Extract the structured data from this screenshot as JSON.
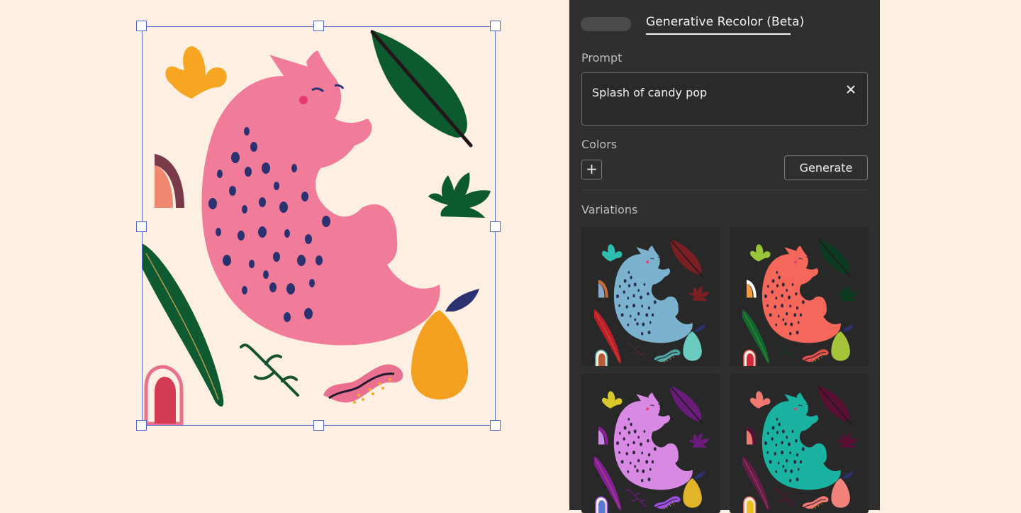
{
  "panel": {
    "tab_label": "Generative Recolor (Beta)",
    "prompt_label": "Prompt",
    "prompt_value": "Splash of candy pop",
    "clear_icon": "close-icon",
    "colors_label": "Colors",
    "add_color_label": "+",
    "generate_label": "Generate",
    "variations_label": "Variations"
  },
  "palettes": {
    "original": {
      "cat": "#f07c9a",
      "spots": "#2c3270",
      "leaf_dark": "#0e5a2f",
      "leaf_tall": "#0f5a30",
      "flower": "#f6a623",
      "pear": "#f3a020",
      "arch": "#f0876f",
      "arch_stroke": "#7a3a4a",
      "plant": "#0e5a2f",
      "wave": "#e9718f",
      "dots": "#f0b020",
      "door": "#d53a55",
      "sprig": "#16522f"
    },
    "variations": [
      {
        "cat": "#7bb3cf",
        "spots": "#2a2f4a",
        "leaf_dark": "#7a1f24",
        "leaf_tall": "#c01f2a",
        "flower": "#2fbdb0",
        "pear": "#6bcbbf",
        "arch": "#8aa6c8",
        "arch_stroke": "#c46c3a",
        "plant": "#7a1f24",
        "wave": "#4fa5a0",
        "dots": "#d9b36a",
        "door": "#b45c3a",
        "sprig": "#4a2a2e"
      },
      {
        "cat": "#f4675a",
        "spots": "#2c2a3a",
        "leaf_dark": "#0a3b20",
        "leaf_tall": "#0f6a2f",
        "flower": "#9ac43a",
        "pear": "#a6c43a",
        "arch": "#f59a3a",
        "arch_stroke": "#ffffff",
        "plant": "#0a3b20",
        "wave": "#e1504b",
        "dots": "#b7d34a",
        "door": "#d0283a",
        "sprig": "#0a3b20"
      },
      {
        "cat": "#d789e4",
        "spots": "#2c2a3a",
        "leaf_dark": "#6a1c7a",
        "leaf_tall": "#8a1f9a",
        "flower": "#d8c72a",
        "pear": "#e2b42a",
        "arch": "#c78ce0",
        "arch_stroke": "#8a1f9a",
        "plant": "#6a1c7a",
        "wave": "#9b4fe0",
        "dots": "#e0c030",
        "door": "#5a7bd0",
        "sprig": "#6a1c7a"
      },
      {
        "cat": "#1ab3a2",
        "spots": "#2c2a3a",
        "leaf_dark": "#5a0f34",
        "leaf_tall": "#6a1a4a",
        "flower": "#f07a72",
        "pear": "#f2837a",
        "arch": "#f07a72",
        "arch_stroke": "#5a0f34",
        "plant": "#5a0f34",
        "wave": "#f07a72",
        "dots": "#e9b030",
        "door": "#e9c020",
        "sprig": "#5a0f34"
      }
    ]
  }
}
